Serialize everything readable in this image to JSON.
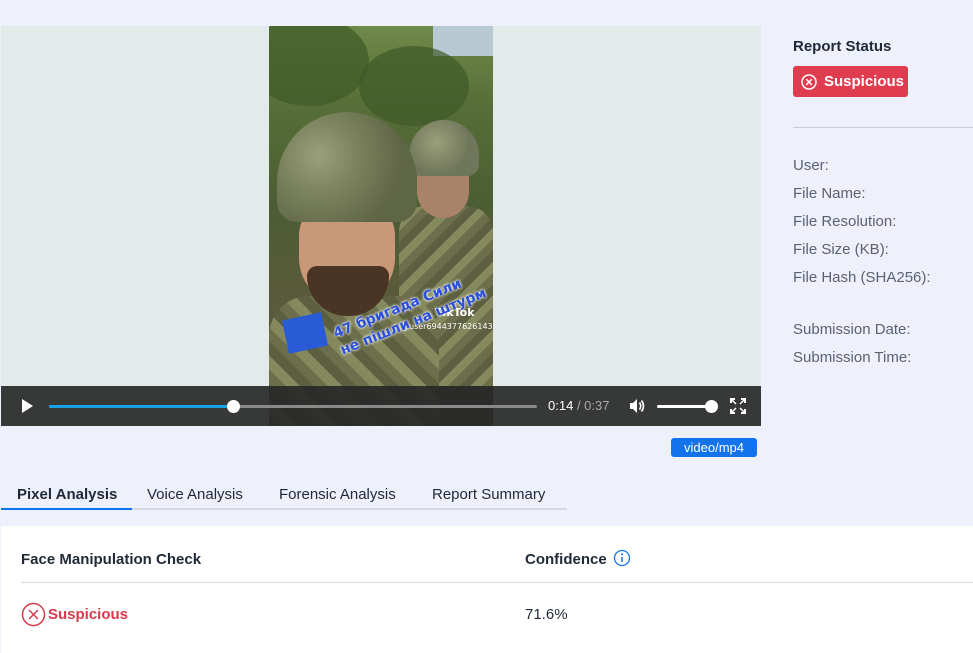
{
  "video": {
    "overlay_brand": "TikTok",
    "overlay_user": "@user6944377626143",
    "caption_line1": "47 бригада Сили",
    "caption_line2": "не пішли на штурм",
    "current_time": "0:14",
    "duration": "/ 0:37",
    "progress_fraction": 0.378,
    "volume_fraction": 1.0,
    "mime_type": "video/mp4"
  },
  "report": {
    "status_title": "Report Status",
    "status_value": "Suspicious",
    "status_color": "#e03c4f",
    "meta": {
      "user": "User:",
      "file_name": "File Name:",
      "file_resolution": "File Resolution:",
      "file_size": "File Size (KB):",
      "file_hash": "File Hash (SHA256):",
      "submission_date": "Submission Date:",
      "submission_time": "Submission Time:"
    }
  },
  "tabs": [
    {
      "label": "Pixel Analysis",
      "active": true
    },
    {
      "label": "Voice Analysis",
      "active": false
    },
    {
      "label": "Forensic Analysis",
      "active": false
    },
    {
      "label": "Report Summary",
      "active": false
    }
  ],
  "table": {
    "headers": {
      "check": "Face Manipulation Check",
      "confidence": "Confidence"
    },
    "rows": [
      {
        "result": "Suspicious",
        "confidence": "71.6%"
      }
    ]
  },
  "colors": {
    "accent": "#1273eb",
    "danger": "#e03c4f",
    "progress": "#17a2e6"
  }
}
